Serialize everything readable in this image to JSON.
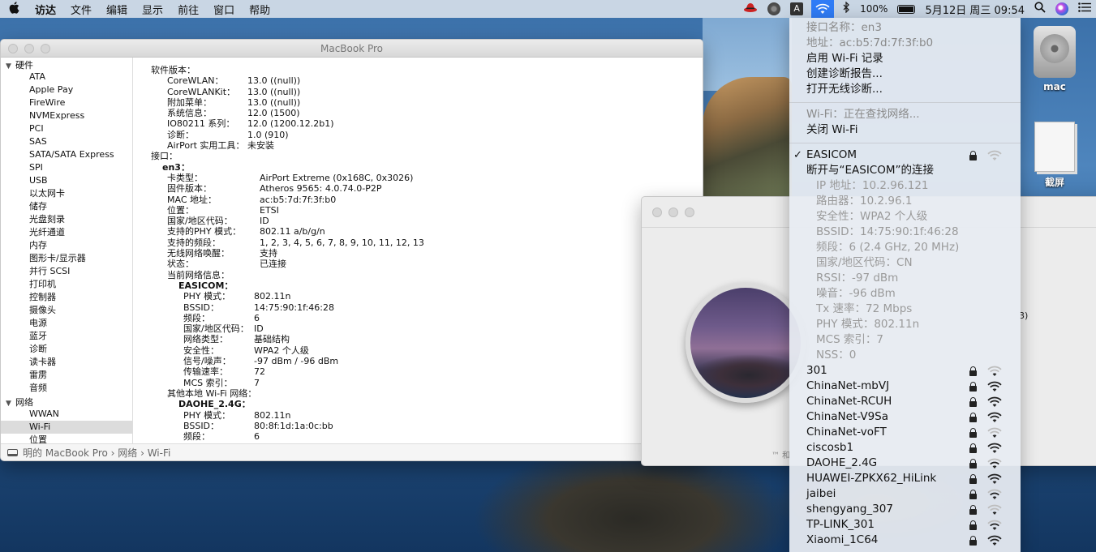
{
  "menubar": {
    "apple": "",
    "items": [
      "访达",
      "文件",
      "编辑",
      "显示",
      "前往",
      "窗口",
      "帮助"
    ],
    "battery_pct": "100%",
    "datetime": "5月12日 周三  09:54"
  },
  "desktop_icons": [
    {
      "label": "mac"
    },
    {
      "label": "截屏"
    }
  ],
  "sysinfo": {
    "title": "MacBook Pro",
    "sidebar": {
      "groups": [
        {
          "label": "硬件",
          "items": [
            "ATA",
            "Apple Pay",
            "FireWire",
            "NVMExpress",
            "PCI",
            "SAS",
            "SATA/SATA Express",
            "SPI",
            "USB",
            "以太网卡",
            "储存",
            "光盘刻录",
            "光纤通道",
            "内存",
            "图形卡/显示器",
            "并行 SCSI",
            "打印机",
            "控制器",
            "摄像头",
            "电源",
            "蓝牙",
            "诊断",
            "读卡器",
            "雷雳",
            "音频"
          ]
        },
        {
          "label": "网络",
          "items": [
            "WWAN",
            "Wi-Fi",
            "位置"
          ]
        }
      ],
      "selected": "Wi-Fi"
    },
    "content": [
      {
        "k": "软件版本：",
        "v": "",
        "ki": 0,
        "vi": 0
      },
      {
        "k": "CoreWLAN：",
        "v": "13.0 ((null))",
        "ki": 1,
        "vi": 1
      },
      {
        "k": "CoreWLANKit：",
        "v": "13.0 ((null))",
        "ki": 1,
        "vi": 1
      },
      {
        "k": "附加菜单：",
        "v": "13.0 ((null))",
        "ki": 1,
        "vi": 1
      },
      {
        "k": "系统信息：",
        "v": "12.0 (1500)",
        "ki": 1,
        "vi": 1
      },
      {
        "k": "IO80211 系列：",
        "v": "12.0 (1200.12.2b1)",
        "ki": 1,
        "vi": 1
      },
      {
        "k": "诊断：",
        "v": "1.0 (910)",
        "ki": 1,
        "vi": 1
      },
      {
        "k": "AirPort 实用工具：",
        "v": "未安装",
        "ki": 1,
        "vi": 1
      },
      {
        "k": "接口：",
        "v": "",
        "ki": 0,
        "vi": 0
      },
      {
        "k": "en3：",
        "v": "",
        "ki": 2,
        "vi": 0,
        "bold": true
      },
      {
        "k": "卡类型：",
        "v": "AirPort Extreme  (0x168C, 0x3026)",
        "ki": 1,
        "vi": 2
      },
      {
        "k": "固件版本：",
        "v": "Atheros 9565: 4.0.74.0-P2P",
        "ki": 1,
        "vi": 2
      },
      {
        "k": "MAC 地址：",
        "v": "ac:b5:7d:7f:3f:b0",
        "ki": 1,
        "vi": 2
      },
      {
        "k": "位置：",
        "v": "ETSI",
        "ki": 1,
        "vi": 2
      },
      {
        "k": "国家/地区代码：",
        "v": "ID",
        "ki": 1,
        "vi": 2
      },
      {
        "k": "支持的PHY 模式：",
        "v": "802.11 a/b/g/n",
        "ki": 1,
        "vi": 2
      },
      {
        "k": "支持的频段：",
        "v": "1, 2, 3, 4, 5, 6, 7, 8, 9, 10, 11, 12, 13",
        "ki": 1,
        "vi": 2
      },
      {
        "k": "无线网络唤醒：",
        "v": "支持",
        "ki": 1,
        "vi": 2
      },
      {
        "k": "状态：",
        "v": "已连接",
        "ki": 1,
        "vi": 2
      },
      {
        "k": "当前网络信息：",
        "v": "",
        "ki": 1,
        "vi": 0
      },
      {
        "k": "EASICOM：",
        "v": "",
        "ki": 3,
        "vi": 0,
        "bold": true
      },
      {
        "k": "PHY 模式：",
        "v": "802.11n",
        "ki": 4,
        "vi": 3
      },
      {
        "k": "BSSID：",
        "v": "14:75:90:1f:46:28",
        "ki": 4,
        "vi": 3
      },
      {
        "k": "频段：",
        "v": "6",
        "ki": 4,
        "vi": 3
      },
      {
        "k": "国家/地区代码：",
        "v": "ID",
        "ki": 4,
        "vi": 3
      },
      {
        "k": "网络类型：",
        "v": "基础结构",
        "ki": 4,
        "vi": 3
      },
      {
        "k": "安全性：",
        "v": "WPA2 个人级",
        "ki": 4,
        "vi": 3
      },
      {
        "k": "信号/噪声：",
        "v": "-97 dBm / -96 dBm",
        "ki": 4,
        "vi": 3
      },
      {
        "k": "传输速率：",
        "v": "72",
        "ki": 4,
        "vi": 3
      },
      {
        "k": "MCS 索引：",
        "v": "7",
        "ki": 4,
        "vi": 3
      },
      {
        "k": "其他本地 Wi-Fi 网络：",
        "v": "",
        "ki": 1,
        "vi": 0
      },
      {
        "k": "DAOHE_2.4G：",
        "v": "",
        "ki": 3,
        "vi": 0,
        "bold": true
      },
      {
        "k": "PHY 模式：",
        "v": "802.11n",
        "ki": 4,
        "vi": 3
      },
      {
        "k": "BSSID：",
        "v": "80:8f:1d:1a:0c:bb",
        "ki": 4,
        "vi": 3
      },
      {
        "k": "频段：",
        "v": "6",
        "ki": 4,
        "vi": 3
      }
    ],
    "path": "明的 MacBook Pro  ›  网络  ›  Wi-Fi"
  },
  "about": {
    "tm_text": "™ 和",
    "trunc_text": "3)"
  },
  "wifi_menu": {
    "interface_name": "接口名称：en3",
    "address": "地址：ac:b5:7d:7f:3f:b0",
    "enable_logging": "启用 Wi-Fi 记录",
    "create_report": "创建诊断报告...",
    "open_diagnostics": "打开无线诊断...",
    "wifi_status": "Wi-Fi：正在查找网络...",
    "turn_off": "关闭 Wi-Fi",
    "current_network": "EASICOM",
    "disconnect": "断开与“EASICOM”的连接",
    "details": [
      "IP 地址：10.2.96.121",
      "路由器：10.2.96.1",
      "安全性：WPA2 个人级",
      "BSSID：14:75:90:1f:46:28",
      "频段：6 (2.4 GHz, 20 MHz)",
      "国家/地区代码：CN",
      "RSSI：-97 dBm",
      "噪音：-96 dBm",
      "Tx 速率：72 Mbps",
      "PHY 模式：802.11n",
      "MCS 索引：7",
      "NSS：0"
    ],
    "networks": [
      {
        "name": "301",
        "strength": 1
      },
      {
        "name": "ChinaNet-mbVJ",
        "strength": 3
      },
      {
        "name": "ChinaNet-RCUH",
        "strength": 3
      },
      {
        "name": "ChinaNet-V9Sa",
        "strength": 3
      },
      {
        "name": "ChinaNet-voFT",
        "strength": 1
      },
      {
        "name": "ciscosb1",
        "strength": 3
      },
      {
        "name": "DAOHE_2.4G",
        "strength": 2
      },
      {
        "name": "HUAWEI-ZPKX62_HiLink",
        "strength": 3
      },
      {
        "name": "jaibei",
        "strength": 2
      },
      {
        "name": "shengyang_307",
        "strength": 1
      },
      {
        "name": "TP-LINK_301",
        "strength": 2
      },
      {
        "name": "Xiaomi_1C64",
        "strength": 3
      }
    ]
  }
}
